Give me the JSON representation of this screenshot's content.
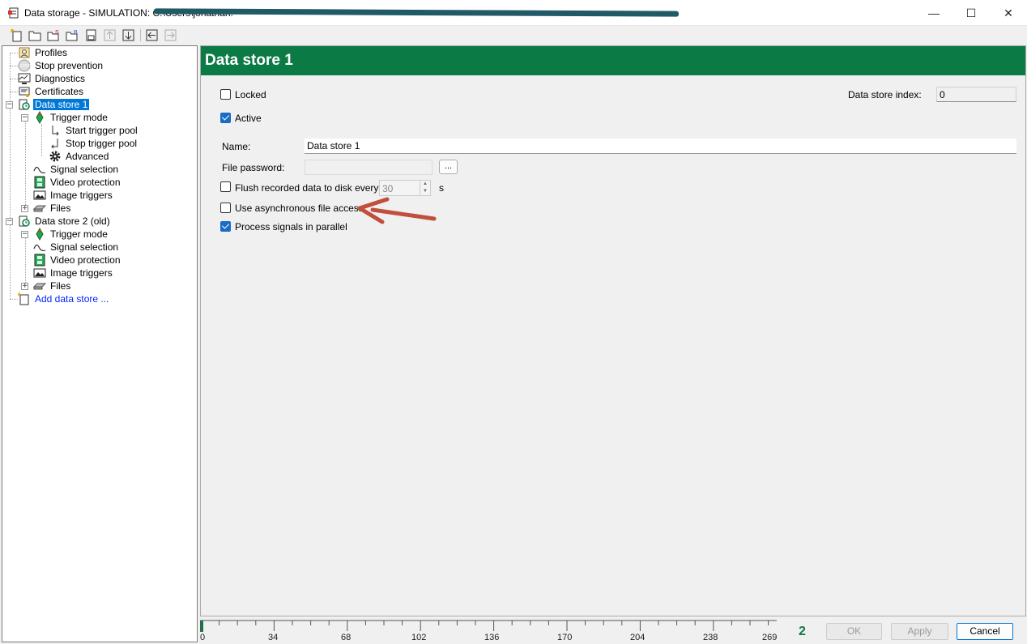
{
  "window": {
    "title_visible": "Data storage - SIMULATION: C:\\Users\\jonathan.",
    "minimize_label": "—",
    "maximize_label": "☐",
    "close_label": "✕"
  },
  "toolbar": {
    "buttons": [
      "new-icon",
      "open-folder-icon",
      "save-icon",
      "save-as-icon",
      "save-disk-icon",
      "move-up-icon",
      "move-down-icon",
      "back-icon",
      "forward-icon"
    ]
  },
  "tree": {
    "items": [
      {
        "label": "Profiles",
        "icon": "profiles-icon"
      },
      {
        "label": "Stop prevention",
        "icon": "stop-icon"
      },
      {
        "label": "Diagnostics",
        "icon": "diagnostics-icon"
      },
      {
        "label": "Certificates",
        "icon": "certificates-icon"
      },
      {
        "label": "Data store 1",
        "icon": "data-store-icon",
        "selected": true
      },
      {
        "label": "Trigger mode",
        "icon": "trigger-icon"
      },
      {
        "label": "Start trigger pool",
        "icon": "start-trigger-icon"
      },
      {
        "label": "Stop trigger pool",
        "icon": "stop-trigger-icon"
      },
      {
        "label": "Advanced",
        "icon": "gear-icon"
      },
      {
        "label": "Signal selection",
        "icon": "signal-icon"
      },
      {
        "label": "Video protection",
        "icon": "film-icon"
      },
      {
        "label": "Image triggers",
        "icon": "image-icon"
      },
      {
        "label": "Files",
        "icon": "disk-icon"
      },
      {
        "label": "Data store 2 (old)",
        "icon": "data-store-icon"
      },
      {
        "label": "Trigger mode",
        "icon": "trigger-icon"
      },
      {
        "label": "Signal selection",
        "icon": "signal-icon"
      },
      {
        "label": "Video protection",
        "icon": "film-icon"
      },
      {
        "label": "Image triggers",
        "icon": "image-icon"
      },
      {
        "label": "Files",
        "icon": "disk-icon"
      },
      {
        "label": "Add data store ...",
        "icon": "add-store-icon",
        "link": true
      }
    ]
  },
  "panel": {
    "title": "Data store 1",
    "locked_label": "Locked",
    "locked_checked": false,
    "active_label": "Active",
    "active_checked": true,
    "index_label": "Data store index:",
    "index_value": "0",
    "name_label": "Name:",
    "name_value": "Data store 1",
    "password_label": "File password:",
    "password_value": "",
    "password_button": "...",
    "flush_label": "Flush recorded data to disk every",
    "flush_checked": false,
    "flush_value": "30",
    "flush_unit": "s",
    "async_label": "Use asynchronous file access",
    "async_checked": false,
    "parallel_label": "Process signals in parallel",
    "parallel_checked": true,
    "annotation_color": "#c0503b"
  },
  "footer": {
    "ruler_labels": [
      "0",
      "34",
      "68",
      "102",
      "136",
      "170",
      "204",
      "238",
      "269"
    ],
    "count": "2",
    "ok_label": "OK",
    "apply_label": "Apply",
    "cancel_label": "Cancel"
  }
}
